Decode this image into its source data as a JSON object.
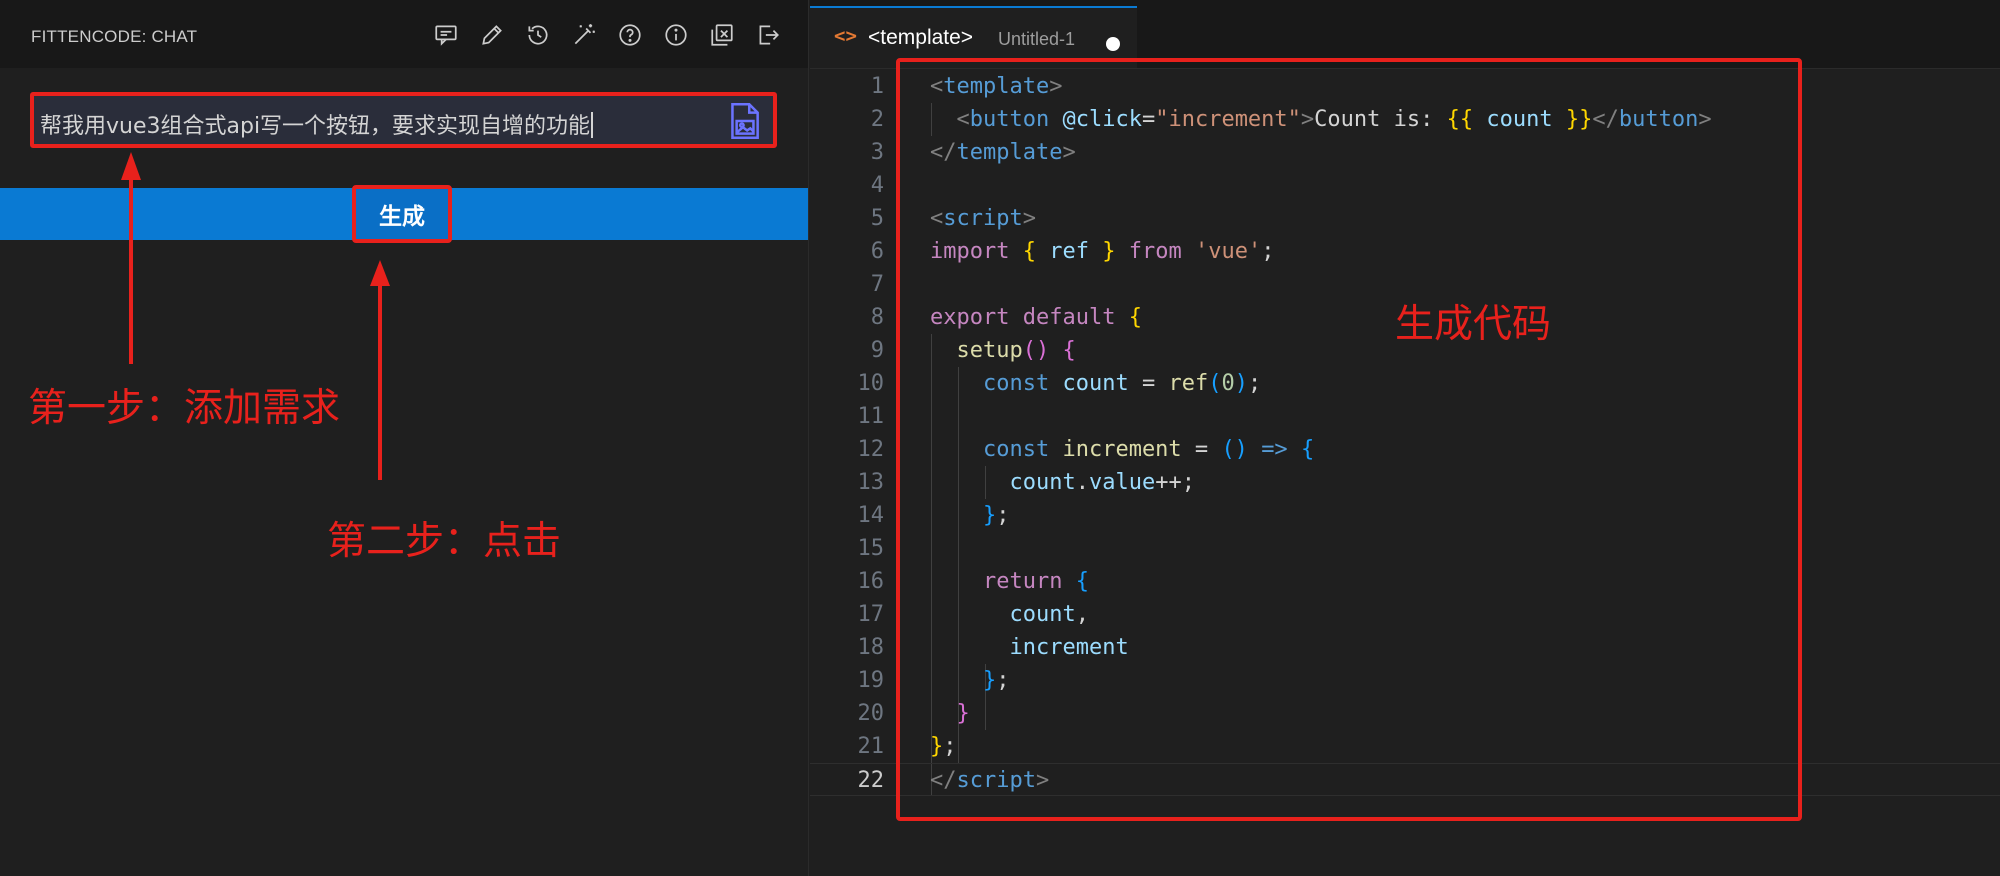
{
  "chat_panel": {
    "title": "FITTENCODE: CHAT",
    "toolbar_icons": [
      "feedback-icon",
      "edit-icon",
      "history-icon",
      "magic-wand-icon",
      "help-icon",
      "info-icon",
      "new-window-icon",
      "logout-icon"
    ],
    "prompt_value": "帮我用vue3组合式api写一个按钮，要求实现自增的功能",
    "generate_label": "生成"
  },
  "annotations": {
    "step1": "第一步：添加需求",
    "step2": "第二步：点击",
    "generated_code": "生成代码"
  },
  "editor": {
    "tab_icon": "<>",
    "tab_name": "<template>",
    "tab_desc": "Untitled-1",
    "active_line": 22,
    "line_numbers": [
      "1",
      "2",
      "3",
      "4",
      "5",
      "6",
      "7",
      "8",
      "9",
      "10",
      "11",
      "12",
      "13",
      "14",
      "15",
      "16",
      "17",
      "18",
      "19",
      "20",
      "21",
      "22"
    ],
    "lines": [
      [
        [
          "t-br",
          "<"
        ],
        [
          "t-tag",
          "template"
        ],
        [
          "t-br",
          ">"
        ]
      ],
      [
        [
          "t-text",
          "  "
        ],
        [
          "t-br",
          "<"
        ],
        [
          "t-tag",
          "button"
        ],
        [
          "t-text",
          " "
        ],
        [
          "t-attr",
          "@click"
        ],
        [
          "t-text",
          "="
        ],
        [
          "t-str",
          "\"increment\""
        ],
        [
          "t-br",
          ">"
        ],
        [
          "t-text",
          "Count is: "
        ],
        [
          "t-p1",
          "{{"
        ],
        [
          "t-text",
          " "
        ],
        [
          "t-var",
          "count"
        ],
        [
          "t-text",
          " "
        ],
        [
          "t-p1",
          "}}"
        ],
        [
          "t-br",
          "</"
        ],
        [
          "t-tag",
          "button"
        ],
        [
          "t-br",
          ">"
        ]
      ],
      [
        [
          "t-br",
          "</"
        ],
        [
          "t-tag",
          "template"
        ],
        [
          "t-br",
          ">"
        ]
      ],
      [],
      [
        [
          "t-br",
          "<"
        ],
        [
          "t-tag",
          "script"
        ],
        [
          "t-br",
          ">"
        ]
      ],
      [
        [
          "t-kw",
          "import"
        ],
        [
          "t-text",
          " "
        ],
        [
          "t-p1",
          "{"
        ],
        [
          "t-text",
          " "
        ],
        [
          "t-var",
          "ref"
        ],
        [
          "t-text",
          " "
        ],
        [
          "t-p1",
          "}"
        ],
        [
          "t-text",
          " "
        ],
        [
          "t-kw",
          "from"
        ],
        [
          "t-text",
          " "
        ],
        [
          "t-str",
          "'vue'"
        ],
        [
          "t-text",
          ";"
        ]
      ],
      [],
      [
        [
          "t-kw",
          "export"
        ],
        [
          "t-text",
          " "
        ],
        [
          "t-kw",
          "default"
        ],
        [
          "t-text",
          " "
        ],
        [
          "t-p1",
          "{"
        ]
      ],
      [
        [
          "t-text",
          "  "
        ],
        [
          "t-fn",
          "setup"
        ],
        [
          "t-p2",
          "()"
        ],
        [
          "t-text",
          " "
        ],
        [
          "t-p2",
          "{"
        ]
      ],
      [
        [
          "t-text",
          "    "
        ],
        [
          "t-kw2",
          "const"
        ],
        [
          "t-text",
          " "
        ],
        [
          "t-var",
          "count"
        ],
        [
          "t-text",
          " = "
        ],
        [
          "t-fn",
          "ref"
        ],
        [
          "t-p3",
          "("
        ],
        [
          "t-num",
          "0"
        ],
        [
          "t-p3",
          ")"
        ],
        [
          "t-text",
          ";"
        ]
      ],
      [],
      [
        [
          "t-text",
          "    "
        ],
        [
          "t-kw2",
          "const"
        ],
        [
          "t-text",
          " "
        ],
        [
          "t-fn",
          "increment"
        ],
        [
          "t-text",
          " = "
        ],
        [
          "t-p3",
          "()"
        ],
        [
          "t-text",
          " "
        ],
        [
          "t-kw2",
          "=>"
        ],
        [
          "t-text",
          " "
        ],
        [
          "t-p3",
          "{"
        ]
      ],
      [
        [
          "t-text",
          "      "
        ],
        [
          "t-var",
          "count"
        ],
        [
          "t-text",
          "."
        ],
        [
          "t-var",
          "value"
        ],
        [
          "t-text",
          "++;"
        ]
      ],
      [
        [
          "t-text",
          "    "
        ],
        [
          "t-p3",
          "}"
        ],
        [
          "t-text",
          ";"
        ]
      ],
      [],
      [
        [
          "t-text",
          "    "
        ],
        [
          "t-kw",
          "return"
        ],
        [
          "t-text",
          " "
        ],
        [
          "t-p3",
          "{"
        ]
      ],
      [
        [
          "t-text",
          "      "
        ],
        [
          "t-var",
          "count"
        ],
        [
          "t-text",
          ","
        ]
      ],
      [
        [
          "t-text",
          "      "
        ],
        [
          "t-var",
          "increment"
        ]
      ],
      [
        [
          "t-text",
          "    "
        ],
        [
          "t-p3",
          "}"
        ],
        [
          "t-text",
          ";"
        ]
      ],
      [
        [
          "t-text",
          "  "
        ],
        [
          "t-p2",
          "}"
        ]
      ],
      [
        [
          "t-p1",
          "}"
        ],
        [
          "t-text",
          ";"
        ]
      ],
      [
        [
          "t-br",
          "</"
        ],
        [
          "t-tag",
          "script"
        ],
        [
          "t-br",
          ">"
        ]
      ]
    ]
  },
  "colors": {
    "accent": "#0a7ad3",
    "annotation": "#e8211c",
    "background": "#1f1f1f"
  }
}
